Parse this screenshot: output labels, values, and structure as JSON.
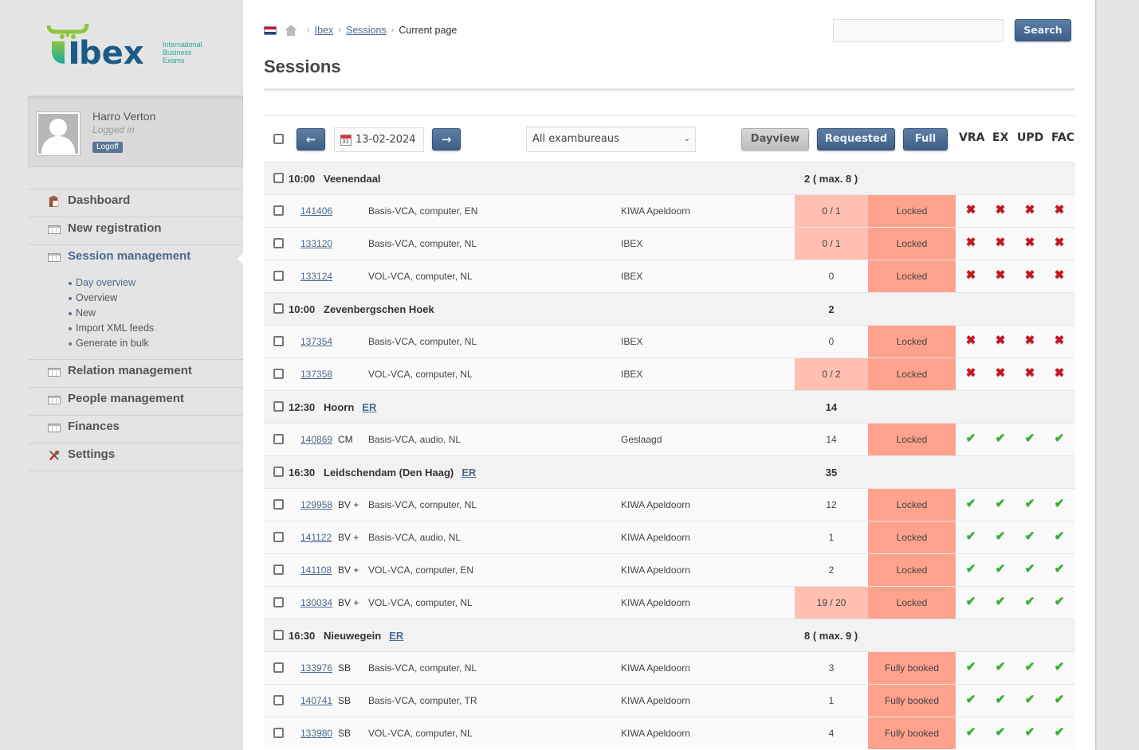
{
  "logo": {
    "brand": "ibex",
    "tagline": [
      "International",
      "Business",
      "Exams"
    ]
  },
  "user": {
    "name": "Harro Verton",
    "status": "Logged in",
    "logoff_label": "Logoff"
  },
  "nav": {
    "items": [
      {
        "label": "Dashboard",
        "icon": "clipboard-icon"
      },
      {
        "label": "New registration",
        "icon": "table-icon"
      },
      {
        "label": "Session management",
        "icon": "table-icon",
        "active": true,
        "subitems": [
          "Day overview",
          "Overview",
          "New",
          "Import XML feeds",
          "Generate in bulk"
        ]
      },
      {
        "label": "Relation management",
        "icon": "table-icon"
      },
      {
        "label": "People management",
        "icon": "table-icon"
      },
      {
        "label": "Finances",
        "icon": "table-icon"
      },
      {
        "label": "Settings",
        "icon": "tools-icon"
      }
    ]
  },
  "breadcrumb": {
    "items": [
      "Ibex",
      "Sessions"
    ],
    "current": "Current page",
    "separator": "›"
  },
  "page": {
    "title": "Sessions"
  },
  "search": {
    "value": "",
    "placeholder": "",
    "button_label": "Search"
  },
  "toolbar": {
    "date": "13-02-2024",
    "calendar_day": "31",
    "prev_icon": "←",
    "next_icon": "→",
    "bureau_select": "All exambureaus",
    "dayview_label": "Dayview",
    "requested_label": "Requested",
    "full_label": "Full",
    "columns": [
      "VRA",
      "EX",
      "UPD",
      "FAC"
    ]
  },
  "colors": {
    "accent": "#4a6a90",
    "status_bg": "#ffa28d",
    "warn_bg": "#ffc0b2",
    "check": "#2db52d",
    "cross": "#c8141e"
  },
  "rows": [
    {
      "type": "group",
      "time": "10:00",
      "location": "Veenendaal",
      "er": "",
      "count": "2 ( max. 8 )"
    },
    {
      "type": "item",
      "id": "141406",
      "code": "",
      "exam": "Basis-VCA, computer, EN",
      "bureau": "KIWA Apeldoorn",
      "count": "0 / 1",
      "warn": true,
      "status": "Locked",
      "marks": [
        "x",
        "x",
        "x",
        "x"
      ]
    },
    {
      "type": "item",
      "id": "133120",
      "code": "",
      "exam": "Basis-VCA, computer, NL",
      "bureau": "IBEX",
      "count": "0 / 1",
      "warn": true,
      "status": "Locked",
      "marks": [
        "x",
        "x",
        "x",
        "x"
      ]
    },
    {
      "type": "item",
      "id": "133124",
      "code": "",
      "exam": "VOL-VCA, computer, NL",
      "bureau": "IBEX",
      "count": "0",
      "warn": false,
      "status": "Locked",
      "marks": [
        "x",
        "x",
        "x",
        "x"
      ]
    },
    {
      "type": "group",
      "time": "10:00",
      "location": "Zevenbergschen Hoek",
      "er": "",
      "count": "2"
    },
    {
      "type": "item",
      "id": "137354",
      "code": "",
      "exam": "Basis-VCA, computer, NL",
      "bureau": "IBEX",
      "count": "0",
      "warn": false,
      "status": "Locked",
      "marks": [
        "x",
        "x",
        "x",
        "x"
      ]
    },
    {
      "type": "item",
      "id": "137358",
      "code": "",
      "exam": "VOL-VCA, computer, NL",
      "bureau": "IBEX",
      "count": "0 / 2",
      "warn": true,
      "status": "Locked",
      "marks": [
        "x",
        "x",
        "x",
        "x"
      ]
    },
    {
      "type": "group",
      "time": "12:30",
      "location": "Hoorn",
      "er": "ER",
      "count": "14"
    },
    {
      "type": "item",
      "id": "140869",
      "code": "CM",
      "exam": "Basis-VCA, audio, NL",
      "bureau": "Geslaagd",
      "count": "14",
      "warn": false,
      "status": "Locked",
      "marks": [
        "ok",
        "ok",
        "ok",
        "ok"
      ]
    },
    {
      "type": "group",
      "time": "16:30",
      "location": "Leidschendam (Den Haag)",
      "er": "ER",
      "count": "35"
    },
    {
      "type": "item",
      "id": "129958",
      "code": "BV +",
      "exam": "Basis-VCA, computer, NL",
      "bureau": "KIWA Apeldoorn",
      "count": "12",
      "warn": false,
      "status": "Locked",
      "marks": [
        "ok",
        "ok",
        "ok",
        "ok"
      ]
    },
    {
      "type": "item",
      "id": "141122",
      "code": "BV +",
      "exam": "Basis-VCA, audio, NL",
      "bureau": "KIWA Apeldoorn",
      "count": "1",
      "warn": false,
      "status": "Locked",
      "marks": [
        "ok",
        "ok",
        "ok",
        "ok"
      ]
    },
    {
      "type": "item",
      "id": "141108",
      "code": "BV +",
      "exam": "VOL-VCA, computer, EN",
      "bureau": "KIWA Apeldoorn",
      "count": "2",
      "warn": false,
      "status": "Locked",
      "marks": [
        "ok",
        "ok",
        "ok",
        "ok"
      ]
    },
    {
      "type": "item",
      "id": "130034",
      "code": "BV +",
      "exam": "VOL-VCA, computer, NL",
      "bureau": "KIWA Apeldoorn",
      "count": "19 / 20",
      "warn": true,
      "status": "Locked",
      "marks": [
        "ok",
        "ok",
        "ok",
        "ok"
      ]
    },
    {
      "type": "group",
      "time": "16:30",
      "location": "Nieuwegein",
      "er": "ER",
      "count": "8 ( max. 9 )"
    },
    {
      "type": "item",
      "id": "133976",
      "code": "SB",
      "exam": "Basis-VCA, computer, NL",
      "bureau": "KIWA Apeldoorn",
      "count": "3",
      "warn": false,
      "status": "Fully booked",
      "marks": [
        "ok",
        "ok",
        "ok",
        "ok"
      ]
    },
    {
      "type": "item",
      "id": "140741",
      "code": "SB",
      "exam": "Basis-VCA, computer, TR",
      "bureau": "KIWA Apeldoorn",
      "count": "1",
      "warn": false,
      "status": "Fully booked",
      "marks": [
        "ok",
        "ok",
        "ok",
        "ok"
      ]
    },
    {
      "type": "item",
      "id": "133980",
      "code": "SB",
      "exam": "VOL-VCA, computer, NL",
      "bureau": "KIWA Apeldoorn",
      "count": "4",
      "warn": false,
      "status": "Fully booked",
      "marks": [
        "ok",
        "ok",
        "ok",
        "ok"
      ]
    }
  ]
}
